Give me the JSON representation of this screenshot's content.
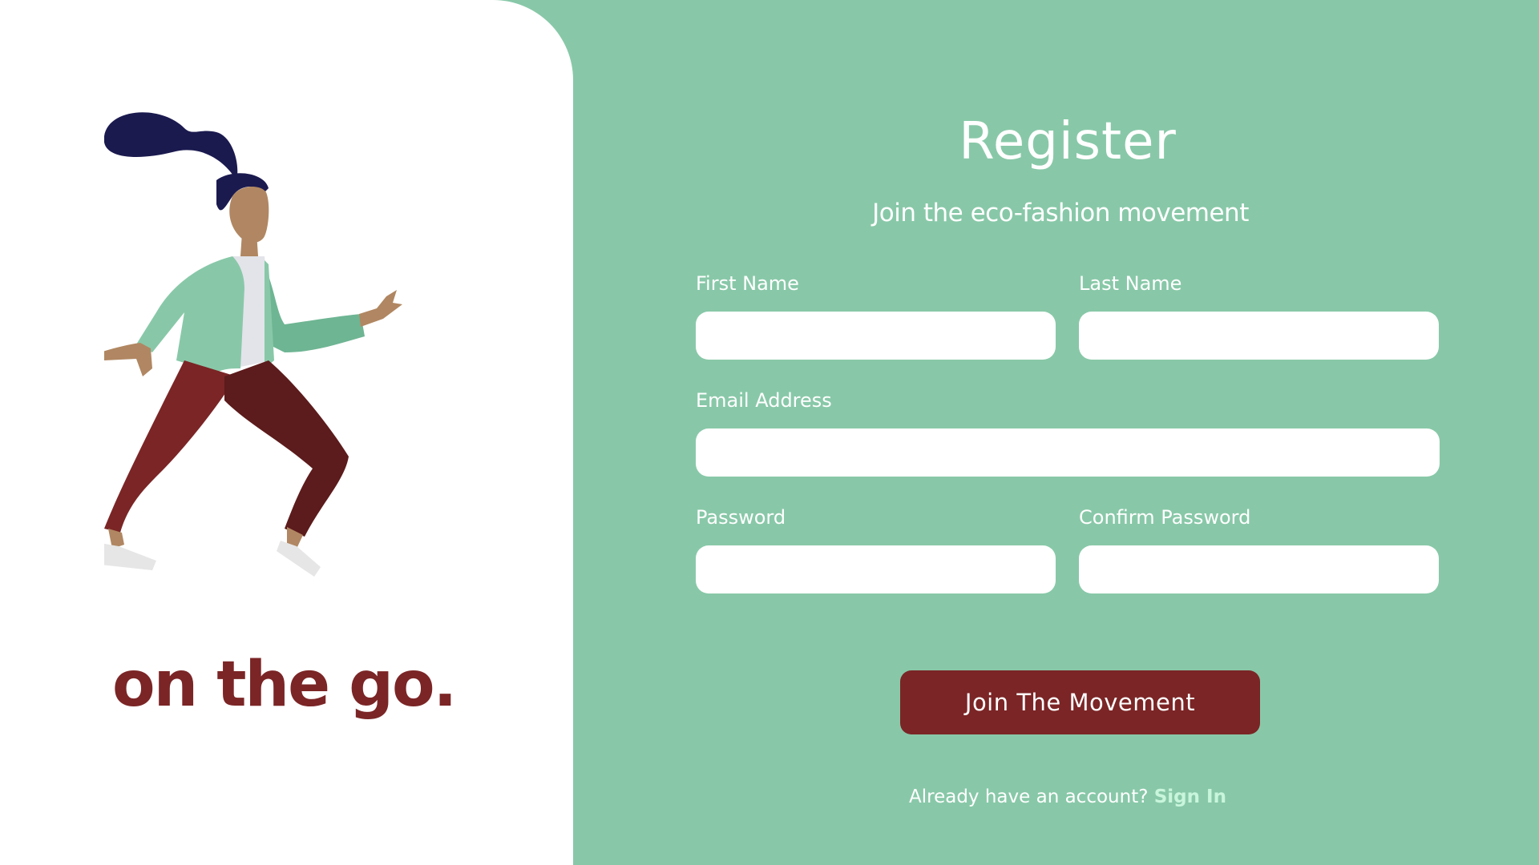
{
  "brand": {
    "tagline": "on the go."
  },
  "form": {
    "title": "Register",
    "subtitle": "Join the eco-fashion movement",
    "fields": {
      "first_name": {
        "label": "First Name",
        "value": "",
        "placeholder": ""
      },
      "last_name": {
        "label": "Last Name",
        "value": "",
        "placeholder": ""
      },
      "email": {
        "label": "Email Address",
        "value": "",
        "placeholder": ""
      },
      "password": {
        "label": "Password",
        "value": "",
        "placeholder": ""
      },
      "confirm_password": {
        "label": "Confirm Password",
        "value": "",
        "placeholder": ""
      }
    },
    "submit_label": "Join The Movement",
    "signin_prompt": "Already have an account?",
    "signin_link": "Sign In"
  },
  "colors": {
    "background": "#88c8a8",
    "panel": "#ffffff",
    "accent": "#7b2526",
    "link": "#c8f5dc"
  },
  "illustration": {
    "icon": "running-woman-illustration"
  }
}
